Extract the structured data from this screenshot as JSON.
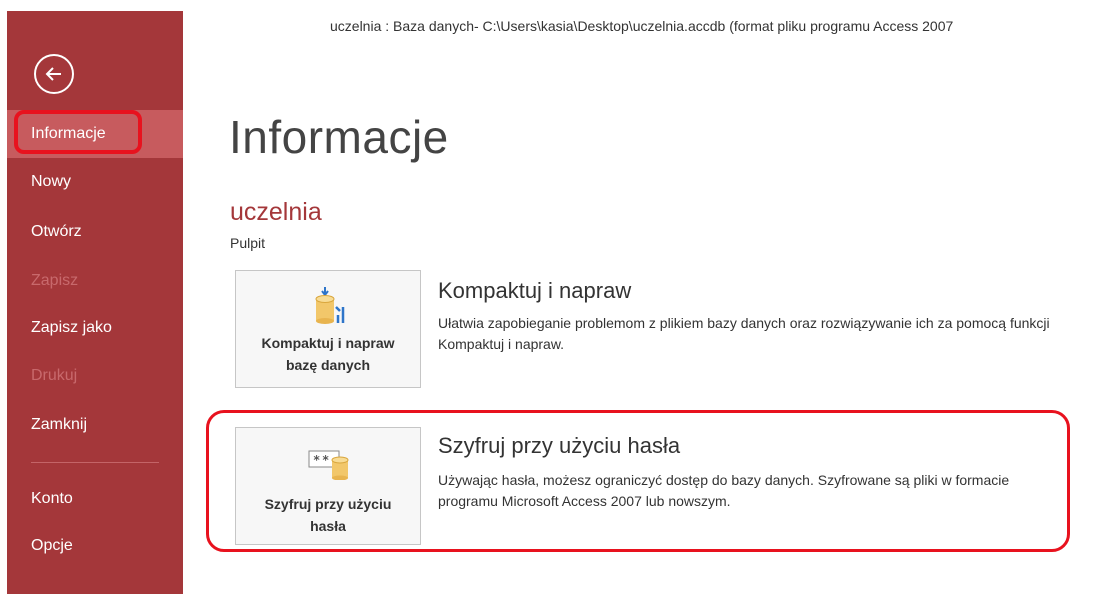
{
  "window": {
    "title": "uczelnia : Baza danych- C:\\Users\\kasia\\Desktop\\uczelnia.accdb (format pliku programu Access 2007"
  },
  "sidebar": {
    "back_icon": "back-arrow-icon",
    "items": [
      {
        "label": "Informacje",
        "state": "selected"
      },
      {
        "label": "Nowy",
        "state": "normal"
      },
      {
        "label": "Otwórz",
        "state": "normal"
      },
      {
        "label": "Zapisz",
        "state": "disabled"
      },
      {
        "label": "Zapisz jako",
        "state": "normal"
      },
      {
        "label": "Drukuj",
        "state": "disabled"
      },
      {
        "label": "Zamknij",
        "state": "normal"
      },
      {
        "label": "Konto",
        "state": "normal"
      },
      {
        "label": "Opcje",
        "state": "normal"
      }
    ]
  },
  "main": {
    "page_title": "Informacje",
    "db_name": "uczelnia",
    "db_location": "Pulpit",
    "sections": [
      {
        "tile_line1": "Kompaktuj i napraw",
        "tile_line2": "bazę danych",
        "title": "Kompaktuj i napraw",
        "description": "Ułatwia zapobieganie problemom z plikiem bazy danych oraz rozwiązywanie ich za pomocą funkcji Kompaktuj i napraw.",
        "icon": "compact-repair-database-icon"
      },
      {
        "tile_line1": "Szyfruj przy użyciu",
        "tile_line2": "hasła",
        "title": "Szyfruj przy użyciu hasła",
        "description": "Używając hasła, możesz ograniczyć dostęp do bazy danych. Szyfrowane są pliki w formacie programu Microsoft Access 2007 lub nowszym.",
        "icon": "encrypt-password-icon"
      }
    ]
  },
  "colors": {
    "sidebar_bg": "#a4373a",
    "accent": "#a4373a",
    "annotation": "#e8121e"
  }
}
